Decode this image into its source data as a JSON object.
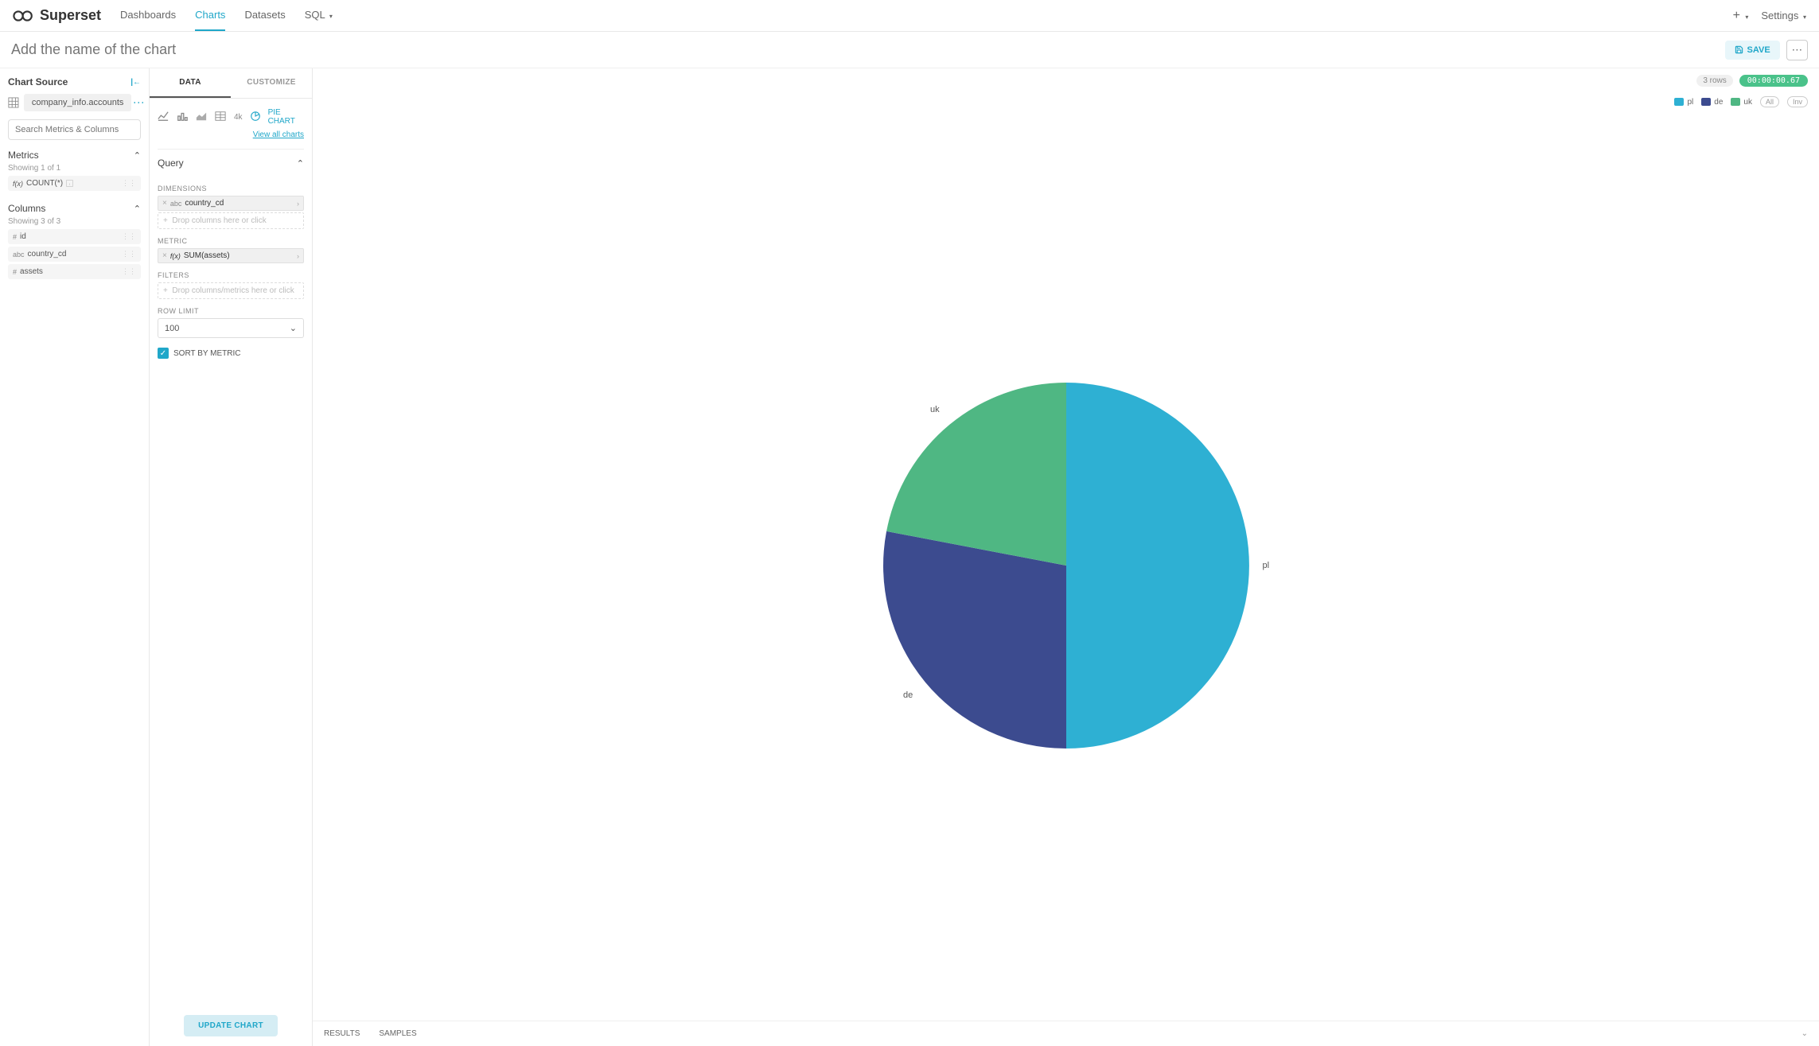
{
  "app": {
    "name": "Superset"
  },
  "nav": {
    "items": [
      "Dashboards",
      "Charts",
      "Datasets",
      "SQL"
    ],
    "active_index": 1,
    "settings": "Settings"
  },
  "titlebar": {
    "placeholder": "Add the name of the chart",
    "save": "SAVE"
  },
  "left": {
    "chart_source_label": "Chart Source",
    "source": "company_info.accounts",
    "search_placeholder": "Search Metrics & Columns",
    "metrics_label": "Metrics",
    "metrics_showing": "Showing 1 of 1",
    "metrics": [
      {
        "type": "f(x)",
        "name": "COUNT(*)"
      }
    ],
    "columns_label": "Columns",
    "columns_showing": "Showing 3 of 3",
    "columns": [
      {
        "type": "#",
        "name": "id"
      },
      {
        "type": "abc",
        "name": "country_cd"
      },
      {
        "type": "#",
        "name": "assets"
      }
    ]
  },
  "control": {
    "tabs": {
      "data": "DATA",
      "customize": "CUSTOMIZE"
    },
    "viz": {
      "big_number": "4k",
      "pie": "PIE CHART",
      "view_all": "View all charts"
    },
    "query_label": "Query",
    "dimensions_label": "DIMENSIONS",
    "dimension_value": "country_cd",
    "drop_hint": "Drop columns here or click",
    "metric_label": "METRIC",
    "metric_value": "SUM(assets)",
    "filters_label": "FILTERS",
    "filters_drop": "Drop columns/metrics here or click",
    "row_limit_label": "ROW LIMIT",
    "row_limit_value": "100",
    "sort_label": "SORT BY METRIC",
    "update_btn": "UPDATE CHART"
  },
  "chart": {
    "rows_badge": "3 rows",
    "time_badge": "00:00:00.67",
    "legend": [
      {
        "name": "pl",
        "color": "#2eb0d3"
      },
      {
        "name": "de",
        "color": "#3c4b8f"
      },
      {
        "name": "uk",
        "color": "#4fb783"
      }
    ],
    "legend_all": "All",
    "legend_inv": "Inv",
    "results_tab": "RESULTS",
    "samples_tab": "SAMPLES"
  },
  "chart_data": {
    "type": "pie",
    "title": "",
    "categories": [
      "pl",
      "de",
      "uk"
    ],
    "values": [
      50,
      28,
      22
    ],
    "colors": [
      "#2eb0d3",
      "#3c4b8f",
      "#4fb783"
    ],
    "metric": "SUM(assets)",
    "dimension": "country_cd"
  }
}
